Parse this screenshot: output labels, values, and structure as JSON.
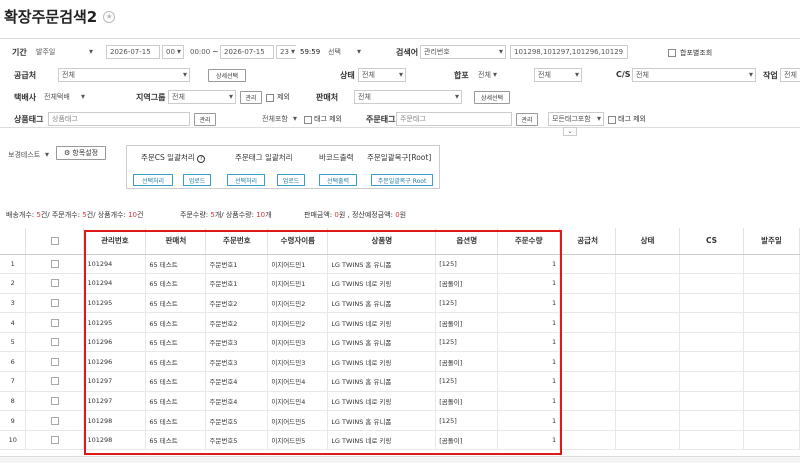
{
  "page": {
    "title": "확장주문검색2",
    "star_icon": "star-icon"
  },
  "filters": {
    "period_label": "기간",
    "period_type": "발주일",
    "date_from": "2026-07-15",
    "hour_from": "00",
    "time_from": "00:00",
    "tilde": "~",
    "date_to": "2026-07-15",
    "hour_to": "23",
    "time_to": "59:59",
    "select_label": "선택",
    "search_word_label": "검색어",
    "search_field": "관리번호",
    "search_value": "101298,101297,101296,10129",
    "merge_label": "합포별조회",
    "supplier_label": "공급처",
    "supplier_value": "전체",
    "detail_select": "상세선택",
    "status_label": "상태",
    "status_value": "전체",
    "merge_pack_label": "합포",
    "merge_pack_value": "전체",
    "merge_pack_value2": "전체",
    "cs_label": "C/S",
    "cs_value": "전체",
    "work_label": "작업",
    "work_value": "전체",
    "courier_label": "택배사",
    "courier_value": "전체택배",
    "region_label": "지역그룹",
    "region_value": "전체",
    "manage_btn": "관리",
    "exclude_label": "제외",
    "seller_label": "판매처",
    "seller_value": "전체",
    "detail_select2": "상세선택",
    "product_tag_label": "상품태그",
    "product_tag_placeholder": "상품태그",
    "manage_btn2": "관리",
    "include_all": "전체포함",
    "tag_exclude": "태그 제외",
    "order_tag_label": "주문태그",
    "order_tag_placeholder": "주문태그",
    "manage_btn3": "관리",
    "all_tags_include": "모든태그포함",
    "tag_exclude2": "태그 제외"
  },
  "toolbar": {
    "view_select": "보경테스트",
    "settings_btn": "항목설정",
    "bulk": {
      "cs_title": "주문CS 일괄처리",
      "tag_title": "주문태그 일괄처리",
      "barcode_title": "바코드출력",
      "restore_title": "주문일괄복구[Root]",
      "select_process": "선택처리",
      "upload": "업로드",
      "select_process2": "선택처리",
      "upload2": "업로드",
      "select_print": "선택출력",
      "restore_root": "주문일괄복구 Root"
    }
  },
  "summary": {
    "ship_label": "배송개수:",
    "ship_val": "5",
    "ship_unit": "건/ 주문개수:",
    "order_val": "5",
    "order_unit": "건/ 상품개수:",
    "product_val": "10",
    "product_unit": "건",
    "qty_label": "주문수량:",
    "qty_val": "5",
    "qty_unit": "개/ 상품수량:",
    "pqty_val": "10",
    "pqty_unit": "개",
    "sales_label": "판매금액:",
    "sales_val": "0",
    "sales_unit": "원 , 정산예정금액:",
    "settle_val": "0",
    "settle_unit": "원"
  },
  "table": {
    "headers": [
      "",
      "",
      "관리번호",
      "판매처",
      "주문번호",
      "수령자이름",
      "상품명",
      "옵션명",
      "주문수량",
      "공급처",
      "상태",
      "CS",
      "발주일"
    ],
    "rows": [
      [
        "1",
        "101294",
        "65 테스트",
        "주문번호1",
        "이지어드민1",
        "LG TWINS 홈 유니폼",
        "[125]",
        "1"
      ],
      [
        "2",
        "101294",
        "65 테스트",
        "주문번호1",
        "이지어드민1",
        "LG TWINS 네로 키링",
        "[곰돌이]",
        "1"
      ],
      [
        "3",
        "101295",
        "65 테스트",
        "주문번호2",
        "이지어드민2",
        "LG TWINS 홈 유니폼",
        "[125]",
        "1"
      ],
      [
        "4",
        "101295",
        "65 테스트",
        "주문번호2",
        "이지어드민2",
        "LG TWINS 네로 키링",
        "[곰돌이]",
        "1"
      ],
      [
        "5",
        "101296",
        "65 테스트",
        "주문번호3",
        "이지어드민3",
        "LG TWINS 홈 유니폼",
        "[125]",
        "1"
      ],
      [
        "6",
        "101296",
        "65 테스트",
        "주문번호3",
        "이지어드민3",
        "LG TWINS 네로 키링",
        "[곰돌이]",
        "1"
      ],
      [
        "7",
        "101297",
        "65 테스트",
        "주문번호4",
        "이지어드민4",
        "LG TWINS 홈 유니폼",
        "[125]",
        "1"
      ],
      [
        "8",
        "101297",
        "65 테스트",
        "주문번호4",
        "이지어드민4",
        "LG TWINS 네로 키링",
        "[곰돌이]",
        "1"
      ],
      [
        "9",
        "101298",
        "65 테스트",
        "주문번호5",
        "이지어드민5",
        "LG TWINS 홈 유니폼",
        "[125]",
        "1"
      ],
      [
        "10",
        "101298",
        "65 테스트",
        "주문번호5",
        "이지어드민5",
        "LG TWINS 네로 키링",
        "[곰돌이]",
        "1"
      ]
    ]
  },
  "colors": {
    "highlight": "#e01818",
    "accent": "#1e7fa8",
    "count": "#d33"
  }
}
